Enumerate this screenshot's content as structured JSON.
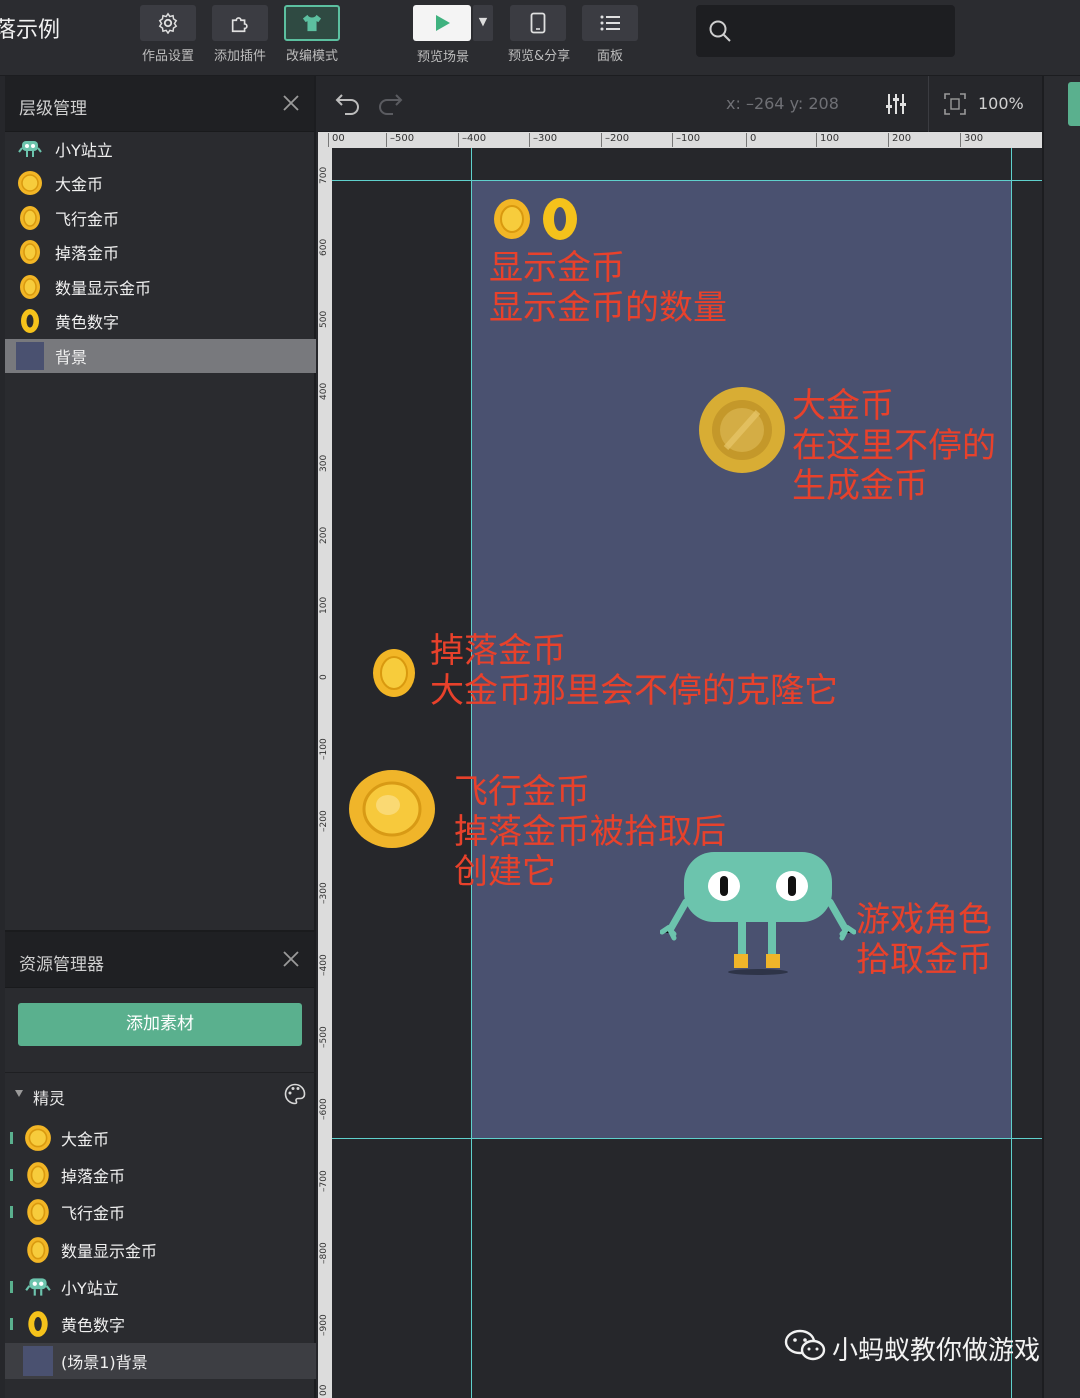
{
  "app": {
    "title": "落示例"
  },
  "toolbar": {
    "settings": "作品设置",
    "plugins": "添加插件",
    "remix": "改编模式",
    "preview_scene": "预览场景",
    "preview_share": "预览&分享",
    "panel": "面板",
    "search_placeholder": ""
  },
  "layers": {
    "title": "层级管理",
    "items": [
      {
        "label": "小Y站立",
        "icon": "robot-icon"
      },
      {
        "label": "大金币",
        "icon": "coin-icon"
      },
      {
        "label": "飞行金币",
        "icon": "coin-icon"
      },
      {
        "label": "掉落金币",
        "icon": "coin-icon"
      },
      {
        "label": "数量显示金币",
        "icon": "coin-icon"
      },
      {
        "label": "黄色数字",
        "icon": "zero-digit-icon"
      },
      {
        "label": "背景",
        "icon": "background-swatch-icon",
        "selected": true
      }
    ]
  },
  "resources": {
    "title": "资源管理器",
    "add_button": "添加素材",
    "section": "精灵",
    "items": [
      {
        "label": "大金币",
        "marked": true
      },
      {
        "label": "掉落金币",
        "marked": true
      },
      {
        "label": "飞行金币",
        "marked": true
      },
      {
        "label": "数量显示金币",
        "marked": false
      },
      {
        "label": "小Y站立",
        "marked": true
      },
      {
        "label": "黄色数字",
        "marked": true
      },
      {
        "label": "(场景1)背景",
        "marked": false,
        "selected": true
      }
    ]
  },
  "stage": {
    "coords": "x: –264  y: 208",
    "zoom": "100%",
    "ruler_x": [
      "00",
      "–500",
      "–400",
      "–300",
      "–200",
      "–100",
      "0",
      "100",
      "200",
      "300"
    ],
    "ruler_y": [
      "700",
      "600",
      "500",
      "400",
      "300",
      "200",
      "100",
      "0",
      "–100",
      "–200",
      "–300",
      "–400",
      "–500",
      "–600",
      "–700",
      "–800",
      "–900",
      "00"
    ],
    "annotations": {
      "display_coin_1": "显示金币",
      "display_coin_2": "显示金币的数量",
      "big_coin_1": "大金币",
      "big_coin_2": "在这里不停的",
      "big_coin_3": "生成金币",
      "drop_coin_1": "掉落金币",
      "drop_coin_2": "大金币那里会不停的克隆它",
      "fly_coin_1": "飞行金币",
      "fly_coin_2": "掉落金币被拾取后",
      "fly_coin_3": "创建它",
      "role_1": "游戏角色",
      "role_2": "拾取金币"
    }
  },
  "watermark": "小蚂蚁教你做游戏",
  "colors": {
    "accent": "#5ab08e",
    "stage_bg": "#4a5170",
    "annotation": "#e8412b",
    "guide": "#5fd0cc"
  }
}
